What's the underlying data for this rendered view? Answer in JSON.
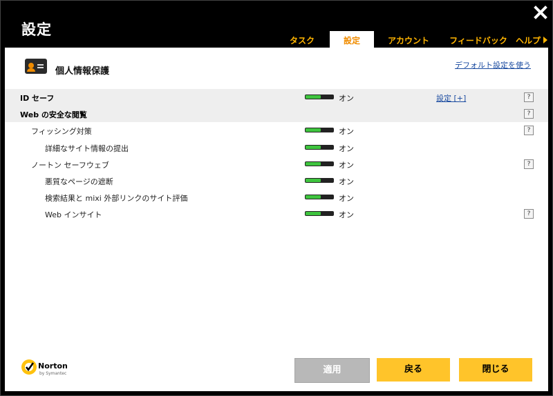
{
  "window": {
    "title": "設定"
  },
  "tabs": [
    {
      "label": "タスク",
      "active": false
    },
    {
      "label": "設定",
      "active": true
    },
    {
      "label": "アカウント",
      "active": false
    },
    {
      "label": "フィードバック",
      "active": false
    },
    {
      "label": "ヘルプ",
      "active": false
    }
  ],
  "header": {
    "title": "個人情報保護",
    "default_link": "デフォルト設定を使う"
  },
  "rows": [
    {
      "label": "ID セーフ",
      "state": "オン",
      "level": 0,
      "bold": true,
      "shaded": true,
      "toggle": true,
      "settings_link": "設定 [+]",
      "help": "?"
    },
    {
      "label": "Web の安全な閲覧",
      "state": "",
      "level": 0,
      "bold": true,
      "shaded": true,
      "toggle": false,
      "settings_link": "",
      "help": "?"
    },
    {
      "label": "フィッシング対策",
      "state": "オン",
      "level": 1,
      "bold": false,
      "shaded": false,
      "toggle": true,
      "settings_link": "",
      "help": "?"
    },
    {
      "label": "詳細なサイト情報の提出",
      "state": "オン",
      "level": 2,
      "bold": false,
      "shaded": false,
      "toggle": true,
      "settings_link": "",
      "help": ""
    },
    {
      "label": "ノートン セーフウェブ",
      "state": "オン",
      "level": 1,
      "bold": false,
      "shaded": false,
      "toggle": true,
      "settings_link": "",
      "help": "?"
    },
    {
      "label": "悪質なページの遮断",
      "state": "オン",
      "level": 2,
      "bold": false,
      "shaded": false,
      "toggle": true,
      "settings_link": "",
      "help": ""
    },
    {
      "label": "検索結果と mixi 外部リンクのサイト評価",
      "state": "オン",
      "level": 2,
      "bold": false,
      "shaded": false,
      "toggle": true,
      "settings_link": "",
      "help": ""
    },
    {
      "label": "Web インサイト",
      "state": "オン",
      "level": 2,
      "bold": false,
      "shaded": false,
      "toggle": true,
      "settings_link": "",
      "help": "?"
    }
  ],
  "toggle_level": 0.55,
  "logo": {
    "name": "Norton",
    "sub": "by Symantec"
  },
  "buttons": {
    "apply": "適用",
    "back": "戻る",
    "close": "閉じる"
  },
  "colors": {
    "accent": "#ffb400",
    "active_tab_text": "#f08c00",
    "toggle_on": "#3ec43e",
    "button": "#ffc42a",
    "button_disabled": "#b8b8b8",
    "link": "#1a4ba0"
  }
}
